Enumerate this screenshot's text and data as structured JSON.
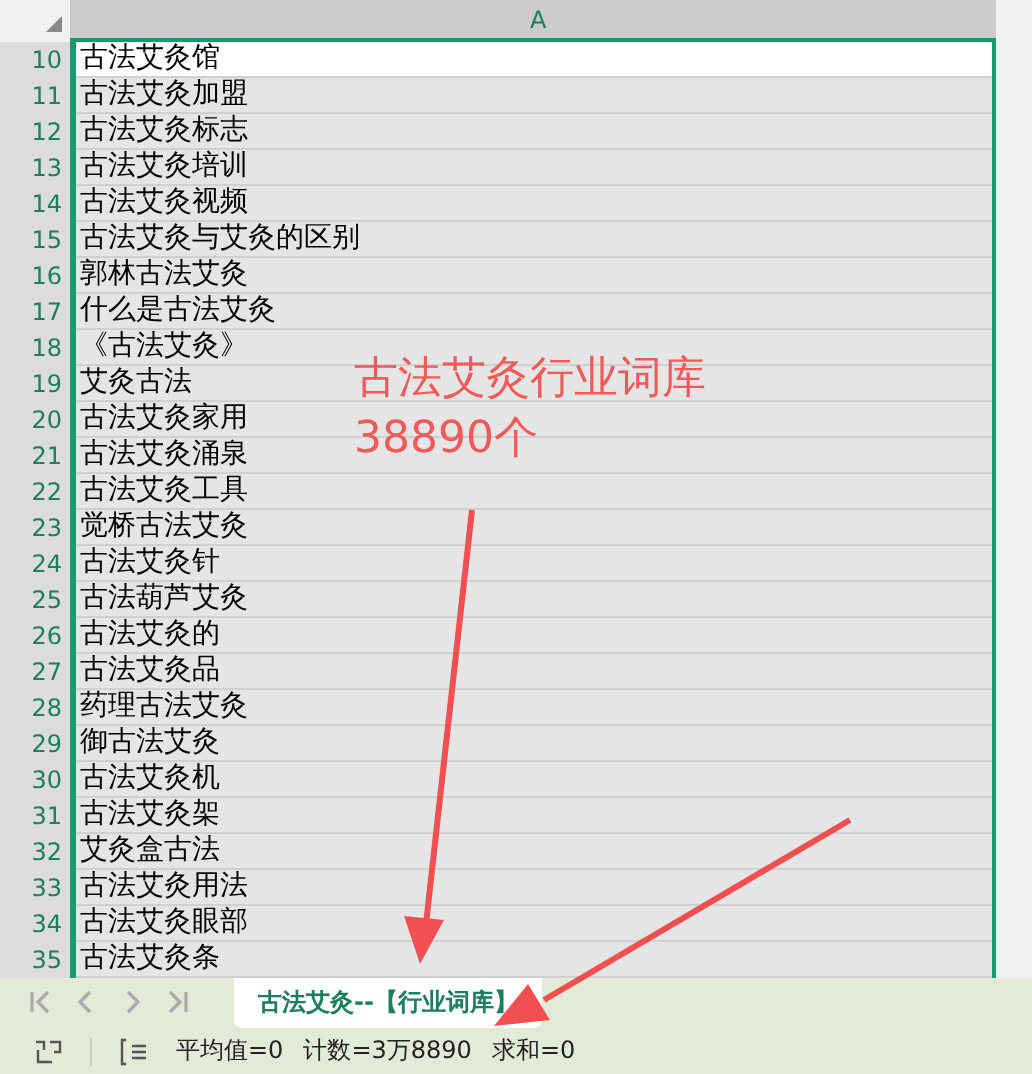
{
  "column_header": "A",
  "rows": [
    {
      "number": "10",
      "text": "古法艾灸馆",
      "active": true
    },
    {
      "number": "11",
      "text": "古法艾灸加盟",
      "active": false
    },
    {
      "number": "12",
      "text": "古法艾灸标志",
      "active": false
    },
    {
      "number": "13",
      "text": "古法艾灸培训",
      "active": false
    },
    {
      "number": "14",
      "text": "古法艾灸视频",
      "active": false
    },
    {
      "number": "15",
      "text": "古法艾灸与艾灸的区别",
      "active": false
    },
    {
      "number": "16",
      "text": "郭林古法艾灸",
      "active": false
    },
    {
      "number": "17",
      "text": "什么是古法艾灸",
      "active": false
    },
    {
      "number": "18",
      "text": "《古法艾灸》",
      "active": false
    },
    {
      "number": "19",
      "text": "艾灸古法",
      "active": false
    },
    {
      "number": "20",
      "text": "古法艾灸家用",
      "active": false
    },
    {
      "number": "21",
      "text": "古法艾灸涌泉",
      "active": false
    },
    {
      "number": "22",
      "text": "古法艾灸工具",
      "active": false
    },
    {
      "number": "23",
      "text": "觉桥古法艾灸",
      "active": false
    },
    {
      "number": "24",
      "text": "古法艾灸针",
      "active": false
    },
    {
      "number": "25",
      "text": "古法葫芦艾灸",
      "active": false
    },
    {
      "number": "26",
      "text": "古法艾灸的",
      "active": false
    },
    {
      "number": "27",
      "text": "古法艾灸品",
      "active": false
    },
    {
      "number": "28",
      "text": "药理古法艾灸",
      "active": false
    },
    {
      "number": "29",
      "text": "御古法艾灸",
      "active": false
    },
    {
      "number": "30",
      "text": "古法艾灸机",
      "active": false
    },
    {
      "number": "31",
      "text": "古法艾灸架",
      "active": false
    },
    {
      "number": "32",
      "text": "艾灸盒古法",
      "active": false
    },
    {
      "number": "33",
      "text": "古法艾灸用法",
      "active": false
    },
    {
      "number": "34",
      "text": "古法艾灸眼部",
      "active": false
    },
    {
      "number": "35",
      "text": "古法艾灸条",
      "active": false
    }
  ],
  "annotation": {
    "lines": [
      "古法艾灸行业词库",
      "38890个"
    ]
  },
  "sheet_tabs": [
    {
      "label": "古法艾灸--【行业词库】",
      "selected": true
    }
  ],
  "status_bar": {
    "items": [
      "平均值=0",
      "计数=3万8890",
      "求和=0"
    ]
  }
}
